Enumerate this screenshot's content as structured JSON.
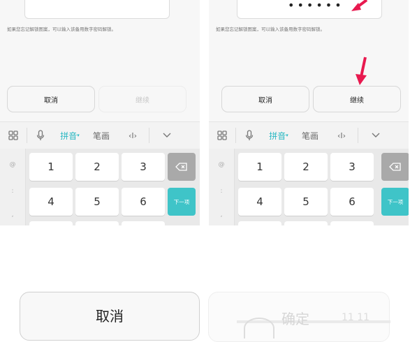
{
  "left": {
    "hint": "如果您忘记解锁图案，可以输入该备用数字密码解锁。",
    "cancel": "取消",
    "continue": "继续"
  },
  "right": {
    "password_mask": "••••••",
    "hint": "如果您忘记解锁图案，可以输入该备用数字密码解锁。",
    "cancel": "取消",
    "continue": "继续"
  },
  "keyboard": {
    "pinyin": "拼音",
    "stroke": "笔画",
    "cursor": "‹I›",
    "symbols": [
      "@",
      ":",
      ","
    ],
    "keys": [
      "1",
      "2",
      "3",
      "4",
      "5",
      "6"
    ],
    "next": "下一项"
  },
  "bottom": {
    "cancel": "取消",
    "confirm": "确定",
    "partial_digits": "11 11"
  },
  "colors": {
    "accent": "#3fc4c8",
    "arrow": "#e8194f",
    "disabled_text": "#c7c7c7"
  },
  "icons": [
    "grid-icon",
    "mic-icon",
    "chevron-down-icon",
    "backspace-icon",
    "arrow-icon"
  ]
}
